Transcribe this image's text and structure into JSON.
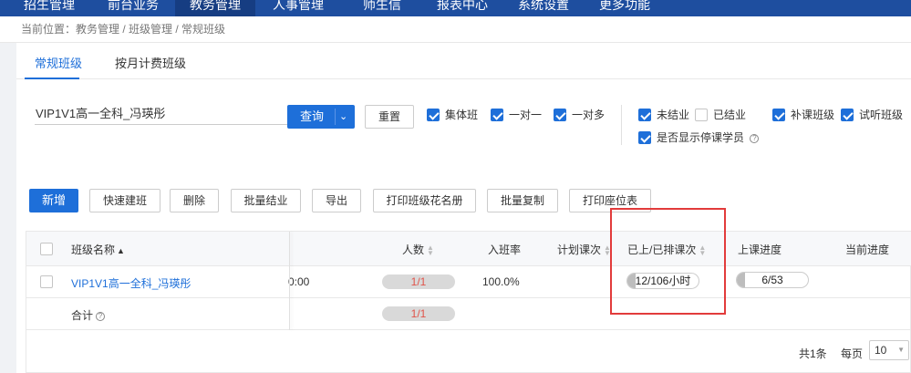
{
  "topnav": {
    "items": [
      "招生管理",
      "前台业务",
      "教务管理",
      "人事管理",
      "师生信",
      "报表中心",
      "系统设置",
      "更多功能"
    ],
    "active_index": 2
  },
  "breadcrumb": "当前位置：教务管理 / 班级管理 / 常规班级",
  "tabs": [
    "常规班级",
    "按月计费班级"
  ],
  "filters": {
    "search_value": "VIP1V1高一全科_冯瑛彤",
    "query_label": "查询",
    "reset_label": "重置",
    "class_type": [
      {
        "label": "集体班",
        "checked": true
      },
      {
        "label": "一对一",
        "checked": true
      },
      {
        "label": "一对多",
        "checked": true
      }
    ],
    "status": [
      {
        "label": "未结业",
        "checked": true
      },
      {
        "label": "已结业",
        "checked": false
      },
      {
        "label": "补课班级",
        "checked": true
      },
      {
        "label": "试听班级",
        "checked": true
      }
    ],
    "show_stopped": {
      "label": "是否显示停课学员",
      "checked": true
    }
  },
  "toolbar": {
    "new": "新增",
    "quick_create": "快速建班",
    "delete": "删除",
    "batch_graduate": "批量结业",
    "export": "导出",
    "print_roster": "打印班级花名册",
    "batch_copy": "批量复制",
    "print_seats": "打印座位表"
  },
  "table": {
    "headers": {
      "class_name": "班级名称",
      "count": "人数",
      "rate": "入班率",
      "planned": "计划课次",
      "done_scheduled": "已上/已排课次",
      "progress": "上课进度",
      "current": "当前进度"
    },
    "rows": [
      {
        "class_name": "VIP1V1高一全科_冯瑛彤",
        "time_fragment": "0:00",
        "count": "1/1",
        "rate": "100.0%",
        "done_scheduled": "12/106小时",
        "done_fraction": 0.11,
        "progress": "6/53",
        "progress_fraction": 0.11
      }
    ],
    "total": {
      "label": "合计",
      "count": "1/1"
    }
  },
  "pagination": {
    "total_text": "共1条",
    "per_page_label": "每页",
    "per_page_value": "10"
  },
  "colors": {
    "primary": "#1e6fd9",
    "nav": "#1e4e9f",
    "highlight": "#e23b3b",
    "count_text": "#e0534a"
  }
}
